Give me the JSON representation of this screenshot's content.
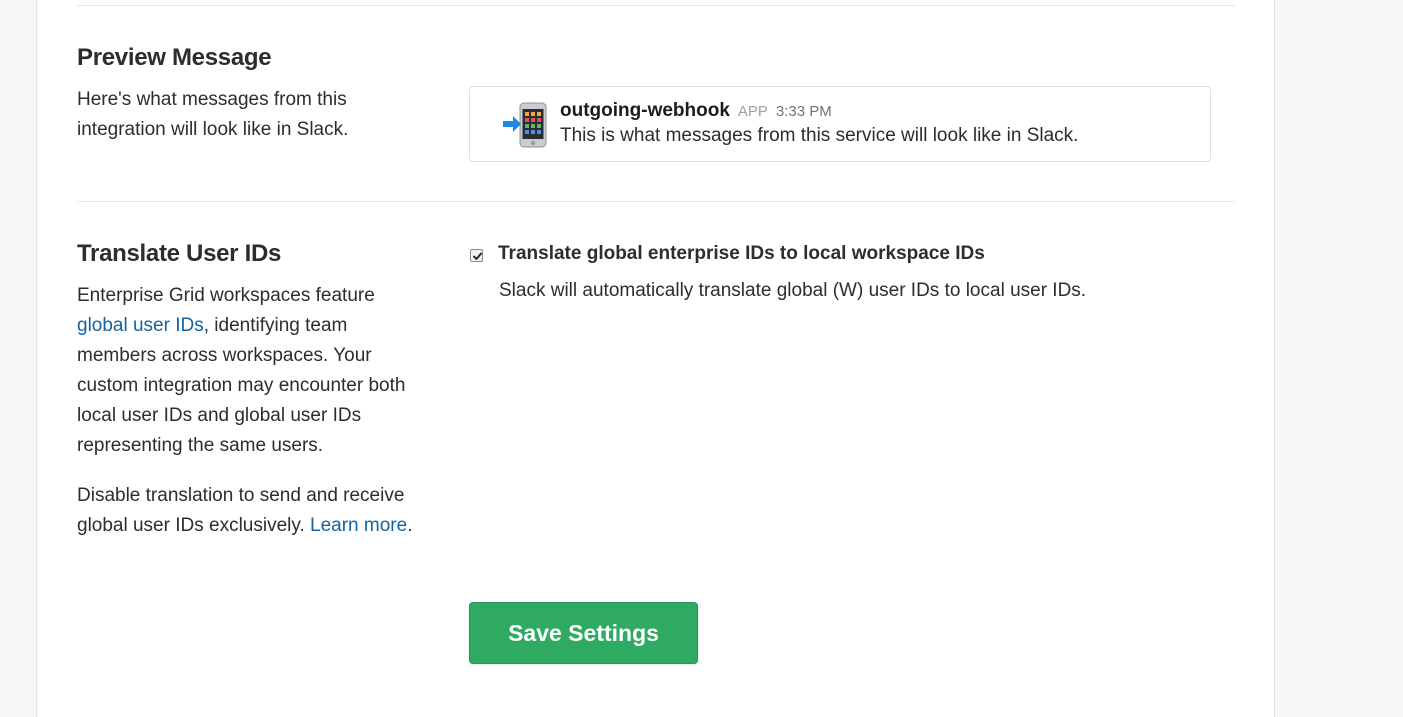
{
  "preview": {
    "title": "Preview Message",
    "description": "Here's what messages from this integration will look like in Slack.",
    "message": {
      "icon": "phone-with-arrow-icon",
      "sender": "outgoing-webhook",
      "badge": "APP",
      "time": "3:33 PM",
      "text": "This is what messages from this service will look like in Slack."
    }
  },
  "translate": {
    "title": "Translate User IDs",
    "desc_p1_prefix": "Enterprise Grid workspaces feature ",
    "desc_p1_link": "global user IDs",
    "desc_p1_suffix": ", identifying team members across workspaces. Your custom integration may encounter both local user IDs and global user IDs representing the same users.",
    "desc_p2_prefix": "Disable translation to send and receive global user IDs exclusively. ",
    "desc_p2_link": "Learn more",
    "desc_p2_suffix": ".",
    "checkbox_checked": true,
    "checkbox_label": "Translate global enterprise IDs to local workspace IDs",
    "checkbox_help": "Slack will automatically translate global (W) user IDs to local user IDs."
  },
  "actions": {
    "save_label": "Save Settings"
  },
  "colors": {
    "accent_green": "#2eaa62",
    "link_blue": "#1264a3"
  }
}
